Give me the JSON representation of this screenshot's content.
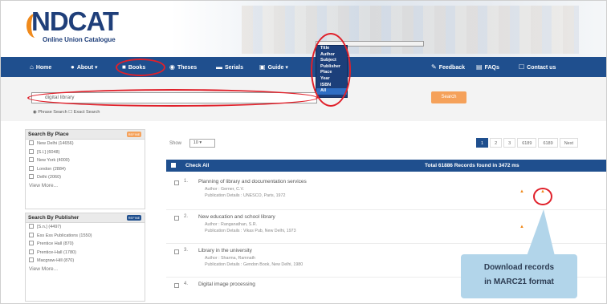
{
  "header": {
    "logo_main_left": "",
    "logo_main_i": "",
    "logo_main_rest": "NDCAT",
    "logo_sub1": "Online Union Catalogue",
    "logo_sub2": ""
  },
  "nav": {
    "items": [
      {
        "label": "Home",
        "icon": "home-icon"
      },
      {
        "label": "About",
        "icon": "info-icon"
      },
      {
        "label": "Books",
        "icon": "book-icon"
      },
      {
        "label": "Theses",
        "icon": "globe-icon"
      },
      {
        "label": "Serials",
        "icon": "serials-icon"
      },
      {
        "label": "Guide",
        "icon": "guide-icon"
      },
      {
        "label": "Feedback",
        "icon": "feedback-icon"
      },
      {
        "label": "FAQs",
        "icon": "faq-icon"
      },
      {
        "label": "Contact us",
        "icon": "contact-icon"
      }
    ]
  },
  "search_field_options": [
    "Title",
    "Author",
    "Subject",
    "Publisher",
    "Place",
    "Year",
    "ISBN",
    "All"
  ],
  "search_field_selected": "All",
  "search": {
    "value": "digital library",
    "button_label": "Search",
    "option_1": "Phrase Search",
    "option_2": "Exact Search"
  },
  "sidebar": {
    "place": {
      "title": "Search By Place",
      "items": [
        "New Delhi (14656)",
        "[S.l.] (6048)",
        "New York (4000)",
        "London (2884)",
        "Delhi (2060)"
      ],
      "more": "View More..."
    },
    "publisher": {
      "title": "Search By Publisher",
      "items": [
        "[S.n.] (4497)",
        "Ess Ess Publications (1550)",
        "Prentice Hall (870)",
        "Prentice-Hall (1780)",
        "Macgraw-Hill (870)"
      ],
      "more": "View More..."
    }
  },
  "results": {
    "show_label": "Show",
    "show_value": "10",
    "pages": [
      "1",
      "2",
      "3",
      "6189",
      "6189",
      "Next"
    ],
    "check_all_label": "Check All",
    "total_label": "Total 61886 Records found in 3472 ms",
    "records": [
      {
        "num": "1.",
        "title": "Planning of library and documentation services",
        "author": "Author : Gerner, C.V.",
        "pub": "Publication Details : UNESCO, Paris, 1972"
      },
      {
        "num": "2.",
        "title": "New education and school library",
        "author": "Author : Ranganathan, S.R.",
        "pub": "Publication Details : Vikas Pub, New Delhi, 1973"
      },
      {
        "num": "3.",
        "title": "Library in the university",
        "author": "Author : Sharma, Ramnath",
        "pub": "Publication Details : Gendon Book, New Delhi, 1980"
      },
      {
        "num": "4.",
        "title": "Digital image processing",
        "author": "",
        "pub": ""
      }
    ]
  },
  "callout": {
    "line1": "Download records",
    "line2": "in MARC21 format"
  },
  "colors": {
    "nav_blue": "#1f4f8e",
    "accent_orange": "#f08a1c",
    "annotation_red": "#e0202a",
    "callout_blue": "#b2d5ea"
  }
}
